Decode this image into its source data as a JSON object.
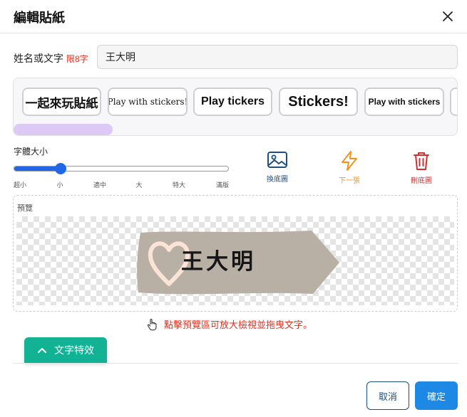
{
  "dialog": {
    "title": "編輯貼紙"
  },
  "name_field": {
    "label": "姓名或文字",
    "limit": "限8字",
    "value": "王大明"
  },
  "font_options": [
    "一起來玩貼紙",
    "Play with stickers!",
    "Play tickers",
    "Stickers!",
    "Play with stickers"
  ],
  "font_size": {
    "label": "字體大小",
    "value_fraction": 0.22,
    "ticks": [
      "超小",
      "小",
      "適中",
      "大",
      "特大",
      "滿版"
    ]
  },
  "actions": {
    "change_bg": "換底圖",
    "next": "下一張",
    "delete_bg": "刪底圖"
  },
  "preview": {
    "label": "預覽",
    "sticker_text": "王大明"
  },
  "hint": "點擊預覽區可放大檢視並拖曳文字。",
  "effects_button": "文字特效",
  "footer": {
    "cancel": "取消",
    "confirm": "確定"
  },
  "colors": {
    "accent_blue": "#1e88e5",
    "slider_blue": "#2266e8",
    "teal": "#12b295",
    "danger": "#d32f2f",
    "warning": "#f2931a",
    "navy": "#1d4f80",
    "scroll_thumb": "#dcc9f6",
    "sticker_bg": "#b8b0a4",
    "heart": "#fbe4d7"
  }
}
